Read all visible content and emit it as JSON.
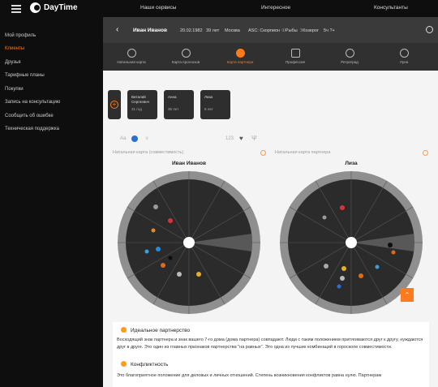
{
  "app": {
    "name": "DayTime"
  },
  "topnav": {
    "services": "Наши сервисы",
    "interesting": "Интересное",
    "consultants": "Консультанты"
  },
  "sidebar": {
    "items": [
      {
        "label": "Мой профиль"
      },
      {
        "label": "Клиенты"
      },
      {
        "label": "Друзья"
      },
      {
        "label": "Тарифные планы"
      },
      {
        "label": "Покупки"
      },
      {
        "label": "Запись на консультацию"
      },
      {
        "label": "Сообщить об ошибке"
      },
      {
        "label": "Техническая поддержка"
      }
    ],
    "active_index": 1
  },
  "profile": {
    "name": "Иван Иванов",
    "date": "20.02.1982",
    "age": "39 лет",
    "city": "Москва",
    "asc": "ASC: Скорпион",
    "signs": "☉Рыбы ☽Козерог",
    "time_label": "5ч ?+"
  },
  "tabs": [
    {
      "label": "Натальная карта"
    },
    {
      "label": "Карта прогнозов"
    },
    {
      "label": "Карта партнера"
    },
    {
      "label": "Профессия"
    },
    {
      "label": "Ретроград"
    },
    {
      "label": "Луна"
    }
  ],
  "active_tab": 2,
  "partners": [
    {
      "name": "Виталий Сергеевич",
      "age": "31 год"
    },
    {
      "name": "Анна",
      "age": "35 лет"
    },
    {
      "name": "Лиза",
      "age": "8 лет"
    }
  ],
  "controls": {
    "aa": "Аа",
    "num": "123"
  },
  "charts": {
    "left_caption": "Натальная карта (совместимость)",
    "right_caption": "Натальная карта партнера",
    "left_name": "Иван Иванов",
    "right_name": "Лиза"
  },
  "info": {
    "h1": "Идеальное партнерство",
    "p1": "Восходящий знак партнера и знак вашего 7-го дома (дома партнера) совпадают. Люди с таким положением притягиваются друг к другу, нуждаются друг в друге. Это один из главных признаков партнерства \"на равных\". Это одна из лучших комбинаций в гороскопе совместимости.",
    "h2": "Конфликтность",
    "p2": "Это благоприятное положение для деловых и личных отношений. Степень возникновения конфликтов равна нулю. Партнерам"
  },
  "colors": {
    "accent": "#ff7a1a",
    "dark": "#0e0e0e"
  },
  "icons": {
    "menu": "menu-icon",
    "back": "chevron-left-icon",
    "settings": "gear-icon",
    "add": "plus-icon",
    "scroll_up": "chevron-up-icon"
  }
}
